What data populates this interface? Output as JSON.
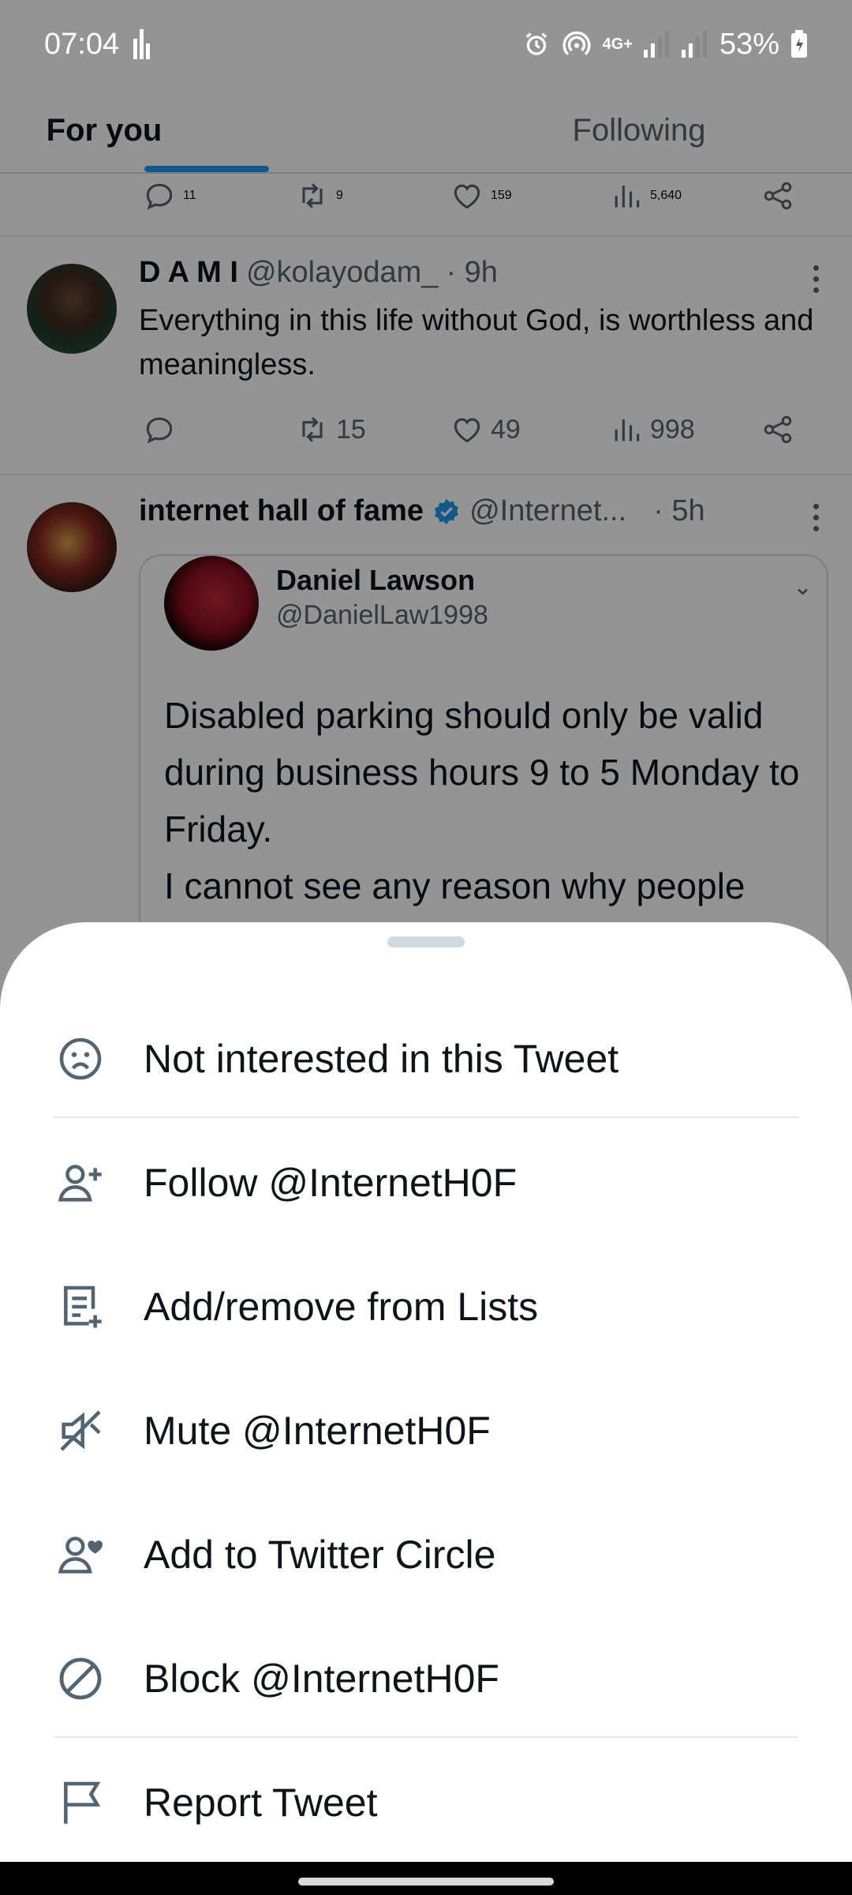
{
  "status_bar": {
    "time": "07:04",
    "network": "4G+",
    "battery": "53%"
  },
  "tabs": [
    {
      "label": "For you",
      "active": true
    },
    {
      "label": "Following",
      "active": false
    }
  ],
  "feed": {
    "top_actions": {
      "replies": "11",
      "retweets": "9",
      "likes": "159",
      "views": "5,640"
    },
    "tweets": [
      {
        "name": "D A M I",
        "handle": "@kolayodam_",
        "time": "· 9h",
        "text": "Everything in this life without God, is worthless and meaningless.",
        "retweets": "15",
        "likes": "49",
        "views": "998"
      },
      {
        "name": "internet hall of fame",
        "verified": true,
        "handle": "@Internet...",
        "time": "· 5h",
        "quote": {
          "name": "Daniel Lawson",
          "handle": "@DanielLaw1998",
          "text": "Disabled parking should only be valid during business hours 9 to 5 Monday to Friday.\nI cannot see any reason why people"
        }
      }
    ]
  },
  "sheet": {
    "items": [
      {
        "label": "Not interested in this Tweet",
        "icon": "sad-face-icon"
      },
      {
        "label": "Follow @InternetH0F",
        "icon": "follow-user-icon"
      },
      {
        "label": "Add/remove from Lists",
        "icon": "list-add-icon"
      },
      {
        "label": "Mute @InternetH0F",
        "icon": "mute-icon"
      },
      {
        "label": "Add to Twitter Circle",
        "icon": "circle-add-icon"
      },
      {
        "label": "Block @InternetH0F",
        "icon": "block-icon"
      },
      {
        "label": "Report Tweet",
        "icon": "flag-icon"
      }
    ]
  },
  "colors": {
    "accent": "#1d9bf0",
    "text_primary": "#0f1419",
    "text_secondary": "#536471",
    "divider": "#e3e8eb"
  }
}
